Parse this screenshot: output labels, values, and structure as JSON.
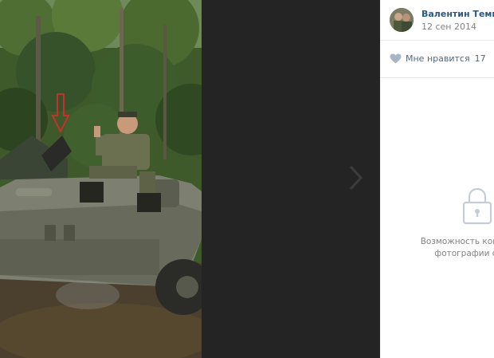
{
  "viewer": {
    "photo_alt": "photo",
    "next_arrow_icon": "chevron-right-icon"
  },
  "author": {
    "name": "Валентин Темнов",
    "date": "12 сен 2014",
    "avatar_icon": "avatar"
  },
  "likes": {
    "label": "Мне нравится",
    "count": "17",
    "icon": "heart-icon"
  },
  "comments": {
    "lock_icon": "lock-icon",
    "note_line1": "Возможность комменти",
    "note_line2": "фотографии огра"
  },
  "colors": {
    "viewer_bg": "#242424",
    "link": "#2a5885",
    "muted": "#828282",
    "like": "#55677d",
    "panel_bg": "#ffffff"
  }
}
